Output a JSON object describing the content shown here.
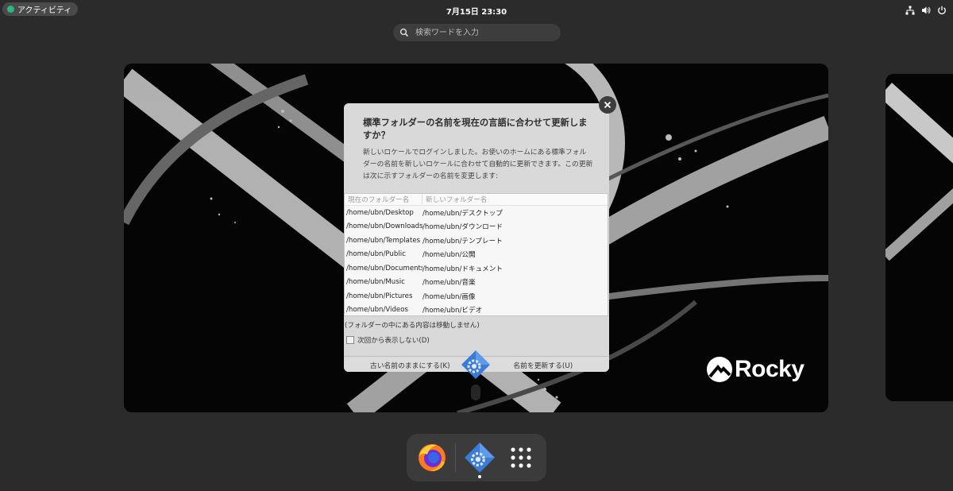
{
  "topbar": {
    "activities_label": "アクティビティ",
    "clock": "7月15日  23:30",
    "tray_icons": [
      "network-icon",
      "volume-icon",
      "power-icon"
    ]
  },
  "search": {
    "placeholder": "検索ワードを入力"
  },
  "workspace": {
    "logo_text": "Rocky"
  },
  "dialog": {
    "title": "標準フォルダーの名前を現在の言語に合わせて更新しますか？",
    "body": "新しいロケールでログインしました。お使いのホームにある標準フォルダーの名前を新しいロケールに合わせて自動的に更新できます。この更新は次に示すフォルダーの名前を変更します:",
    "columns": [
      "現在のフォルダー名",
      "新しいフォルダー名"
    ],
    "rows": [
      [
        "/home/ubn/Desktop",
        "/home/ubn/デスクトップ"
      ],
      [
        "/home/ubn/Downloads",
        "/home/ubn/ダウンロード"
      ],
      [
        "/home/ubn/Templates",
        "/home/ubn/テンプレート"
      ],
      [
        "/home/ubn/Public",
        "/home/ubn/公開"
      ],
      [
        "/home/ubn/Documents",
        "/home/ubn/ドキュメント"
      ],
      [
        "/home/ubn/Music",
        "/home/ubn/音楽"
      ],
      [
        "/home/ubn/Pictures",
        "/home/ubn/画像"
      ],
      [
        "/home/ubn/Videos",
        "/home/ubn/ビデオ"
      ]
    ],
    "note": "(フォルダーの中にある内容は移動しません)",
    "checkbox_label": "次回から表示しない(D)",
    "checkbox_checked": false,
    "keep_button": "古い名前のままにする(K)",
    "update_button": "名前を更新する(U)"
  },
  "dock": {
    "items": [
      "firefox-icon",
      "settings-app-icon",
      "app-grid-icon"
    ]
  },
  "colors": {
    "panel_bg": "#2b2b2b",
    "dialog_bg": "#d9d9d9",
    "activities_dot": "#2fb57e",
    "app_badge_blue": "#3a7bd5"
  }
}
